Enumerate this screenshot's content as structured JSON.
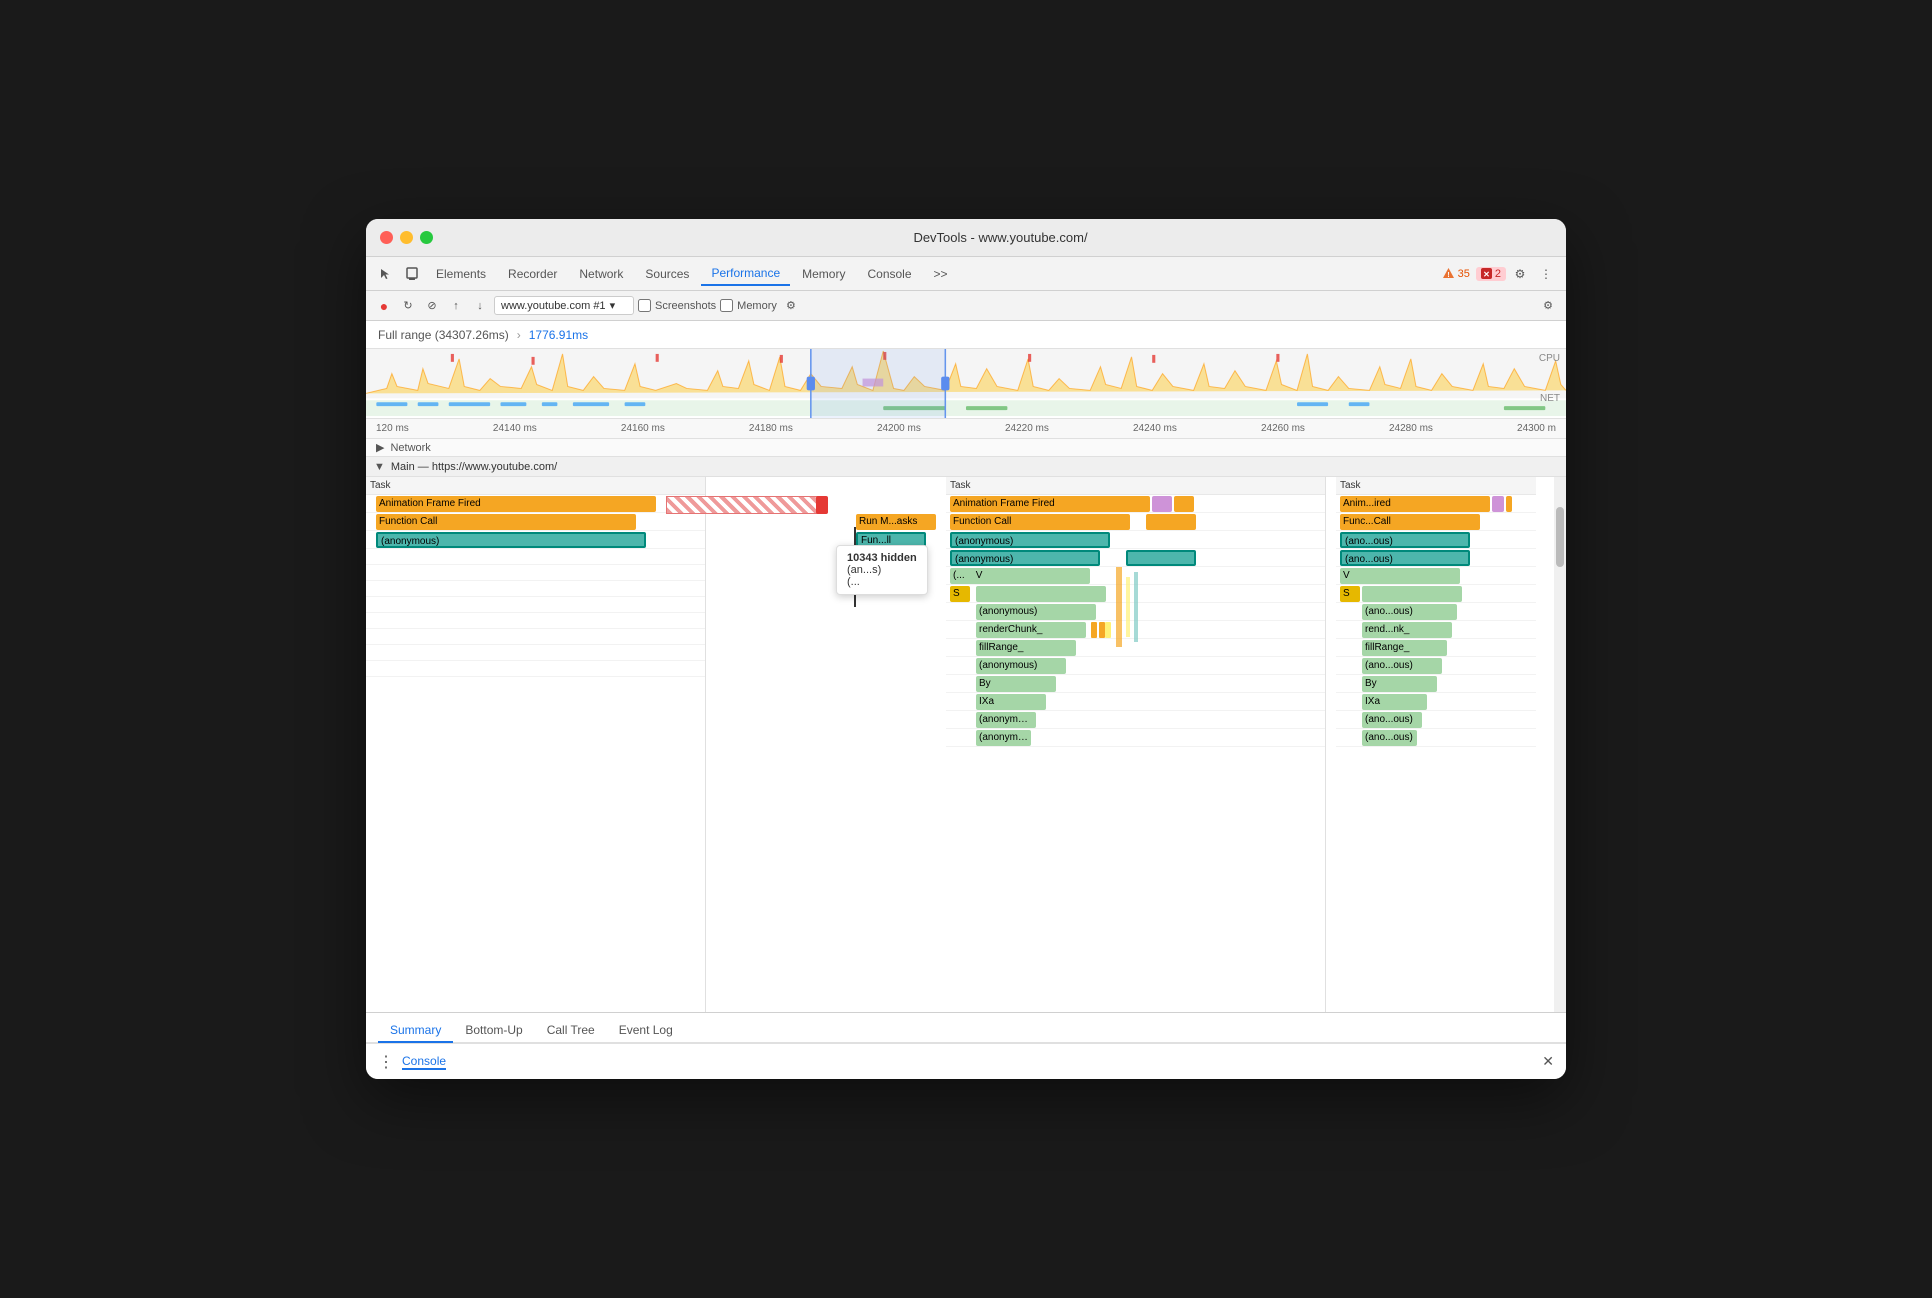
{
  "window": {
    "title": "DevTools - www.youtube.com/"
  },
  "tabs": {
    "items": [
      {
        "label": "Elements"
      },
      {
        "label": "Recorder"
      },
      {
        "label": "Network"
      },
      {
        "label": "Sources"
      },
      {
        "label": "Performance",
        "active": true
      },
      {
        "label": "Memory"
      },
      {
        "label": "Console"
      },
      {
        "label": ">>"
      }
    ]
  },
  "toolbar": {
    "record_label": "●",
    "refresh_label": "↻",
    "clear_label": "⊘",
    "upload_label": "↑",
    "download_label": "↓",
    "url_value": "www.youtube.com #1",
    "screenshots_label": "Screenshots",
    "memory_label": "Memory",
    "settings_label": "⚙",
    "warning_count": "35",
    "error_count": "2"
  },
  "range": {
    "full_label": "Full range (34307.26ms)",
    "arrow": "›",
    "selected_label": "1776.91ms"
  },
  "ruler": {
    "ticks": [
      "120 ms",
      "24140 ms",
      "24160 ms",
      "24180 ms",
      "24200 ms",
      "24220 ms",
      "24240 ms",
      "24260 ms",
      "24280 ms",
      "24300 m"
    ]
  },
  "network_row": {
    "label": "▶ Network"
  },
  "main_section": {
    "label": "Main — https://www.youtube.com/"
  },
  "flame_chart": {
    "columns": [
      {
        "task_label": "Task",
        "rows": [
          {
            "label": "Animation Frame Fired",
            "color": "anim"
          },
          {
            "label": "Function Call",
            "color": "func"
          },
          {
            "label": "(anonymous)",
            "color": "anon"
          },
          {
            "label": "",
            "color": "green"
          },
          {
            "label": "",
            "color": "green"
          },
          {
            "label": "",
            "color": "green"
          },
          {
            "label": "",
            "color": "green"
          },
          {
            "label": "",
            "color": "green"
          },
          {
            "label": "",
            "color": "green"
          },
          {
            "label": "",
            "color": "green"
          },
          {
            "label": "",
            "color": "green"
          }
        ]
      },
      {
        "task_label": "Task",
        "rows": [
          {
            "label": "Animation Frame Fired",
            "color": "anim"
          },
          {
            "label": "Function Call",
            "color": "func"
          },
          {
            "label": "(anonymous)",
            "color": "anon"
          },
          {
            "label": "(anonymous)",
            "color": "anon"
          },
          {
            "label": "(...   V",
            "color": "green"
          },
          {
            "label": "S",
            "color": "yellow"
          },
          {
            "label": "(anonymous)",
            "color": "green"
          },
          {
            "label": "renderChunk_",
            "color": "green"
          },
          {
            "label": "fillRange_",
            "color": "green"
          },
          {
            "label": "(anonymous)",
            "color": "green"
          },
          {
            "label": "By",
            "color": "green"
          },
          {
            "label": "IXa",
            "color": "green"
          },
          {
            "label": "(anonymous)",
            "color": "green"
          },
          {
            "label": "(anonymous)",
            "color": "green"
          }
        ]
      },
      {
        "task_label": "Task",
        "rows": [
          {
            "label": "Anim...ired",
            "color": "anim"
          },
          {
            "label": "Func...Call",
            "color": "func"
          },
          {
            "label": "(ano...ous)",
            "color": "anon"
          },
          {
            "label": "(ano...ous)",
            "color": "anon"
          },
          {
            "label": "V",
            "color": "green"
          },
          {
            "label": "S",
            "color": "yellow"
          },
          {
            "label": "(ano...ous)",
            "color": "green"
          },
          {
            "label": "rend...nk_",
            "color": "green"
          },
          {
            "label": "fillRange_",
            "color": "green"
          },
          {
            "label": "(ano...ous)",
            "color": "green"
          },
          {
            "label": "By",
            "color": "green"
          },
          {
            "label": "IXa",
            "color": "green"
          },
          {
            "label": "(ano...ous)",
            "color": "green"
          },
          {
            "label": "(ano...ous)",
            "color": "green"
          }
        ]
      }
    ],
    "tooltip": {
      "row1": "Fun...ll",
      "row2": "10343 hidden",
      "row3": "(an...s)",
      "row4": "(..."
    }
  },
  "bottom_tabs": {
    "items": [
      {
        "label": "Summary",
        "active": true
      },
      {
        "label": "Bottom-Up"
      },
      {
        "label": "Call Tree"
      },
      {
        "label": "Event Log"
      }
    ]
  },
  "console_bar": {
    "dots": "⋮",
    "link": "Console",
    "close": "✕"
  }
}
